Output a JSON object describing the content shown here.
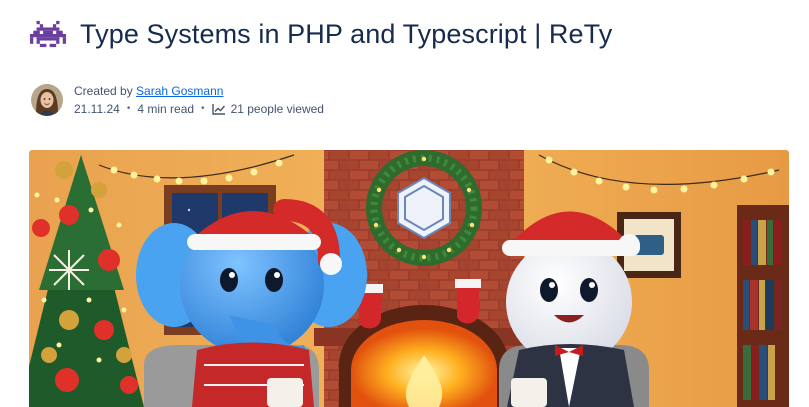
{
  "page": {
    "title": "Type Systems in PHP and Typescript | ReTy",
    "emoji_icon": "purple-space-invader-icon"
  },
  "byline": {
    "created_by_label": "Created by",
    "author": "Sarah Gosmann",
    "date": "21.11.24",
    "separator": "•",
    "read_time": "4 min read",
    "views_icon": "trend-chart-icon",
    "views_text": "21 people viewed"
  },
  "hero_image": {
    "description_icon": "christmas-elephant-and-character-banner"
  },
  "colors": {
    "title": "#172b4d",
    "meta": "#44546f",
    "link": "#0c66e4"
  }
}
